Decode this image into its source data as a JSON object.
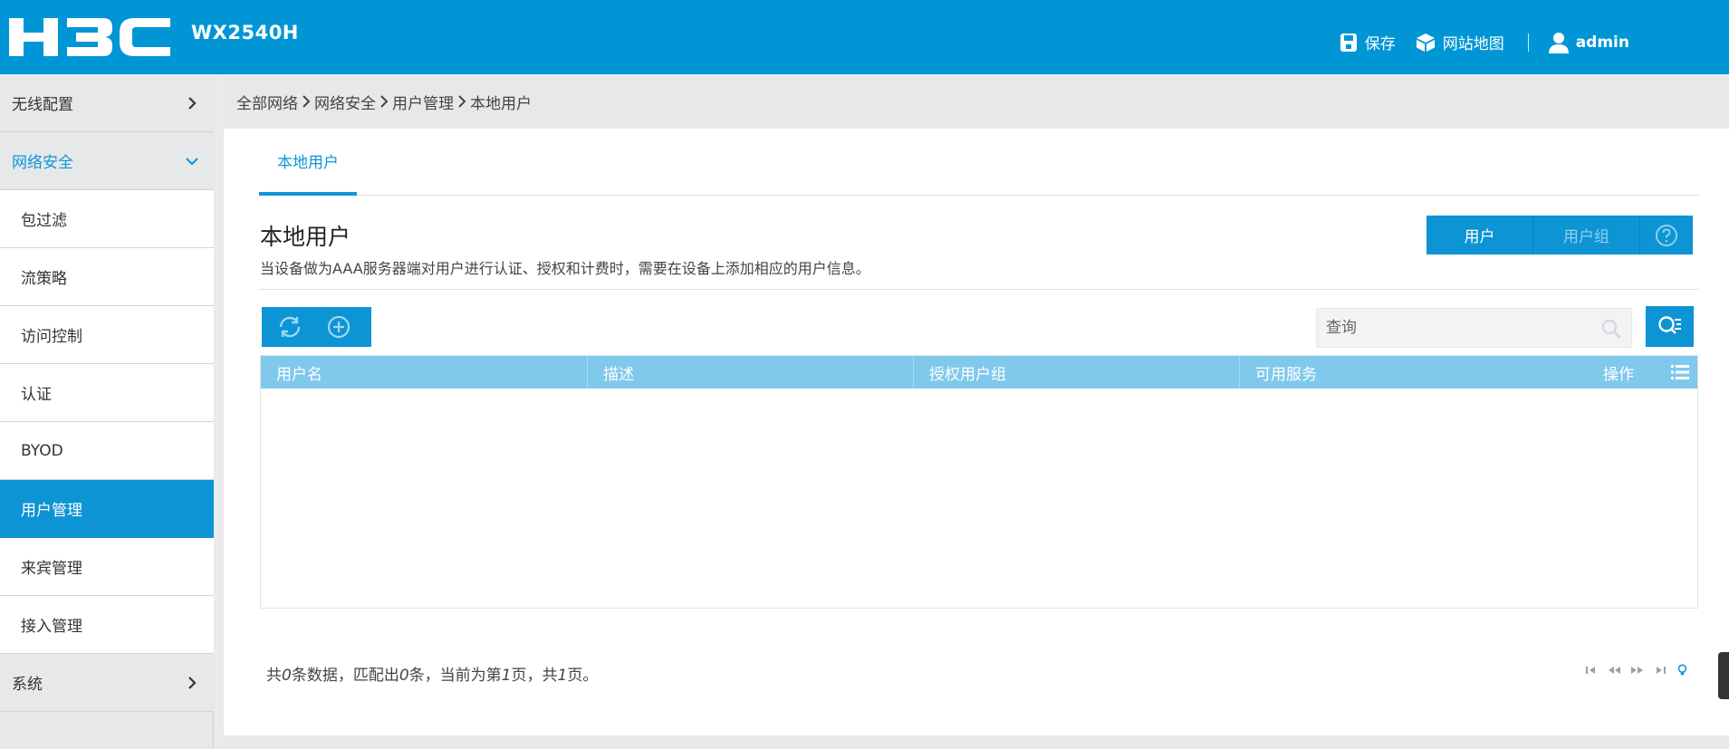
{
  "header": {
    "brand": "H3C",
    "model": "WX2540H",
    "save_label": "保存",
    "sitemap_label": "网站地图",
    "user": "admin"
  },
  "sidebar": {
    "items": [
      {
        "label": "无线配置",
        "type": "top",
        "state": "collapsed"
      },
      {
        "label": "网络安全",
        "type": "top",
        "state": "expanded"
      },
      {
        "label": "包过滤",
        "type": "sub"
      },
      {
        "label": "流策略",
        "type": "sub"
      },
      {
        "label": "访问控制",
        "type": "sub"
      },
      {
        "label": "认证",
        "type": "sub"
      },
      {
        "label": "BYOD",
        "type": "sub"
      },
      {
        "label": "用户管理",
        "type": "sub",
        "active": true
      },
      {
        "label": "来宾管理",
        "type": "sub"
      },
      {
        "label": "接入管理",
        "type": "sub"
      },
      {
        "label": "系统",
        "type": "top",
        "state": "collapsed"
      }
    ]
  },
  "breadcrumb": [
    "全部网络",
    "网络安全",
    "用户管理",
    "本地用户"
  ],
  "tabs": [
    {
      "label": "本地用户",
      "active": true
    }
  ],
  "section": {
    "title": "本地用户",
    "description": "当设备做为AAA服务器端对用户进行认证、授权和计费时，需要在设备上添加相应的用户信息。"
  },
  "segments": {
    "users": "用户",
    "groups": "用户组"
  },
  "search": {
    "placeholder": "查询"
  },
  "table": {
    "columns": [
      "用户名",
      "描述",
      "授权用户组",
      "可用服务"
    ],
    "ops_label": "操作",
    "rows": []
  },
  "summary": {
    "t1": "共",
    "total": "0",
    "t2": "条数据，匹配出",
    "matched": "0",
    "t3": "条，当前为第",
    "page": "1",
    "t4": "页，共",
    "pages": "1",
    "t5": "页。"
  },
  "colors": {
    "brand": "#0096d6",
    "active": "#0d94d5",
    "table_header": "#80c9ec"
  }
}
